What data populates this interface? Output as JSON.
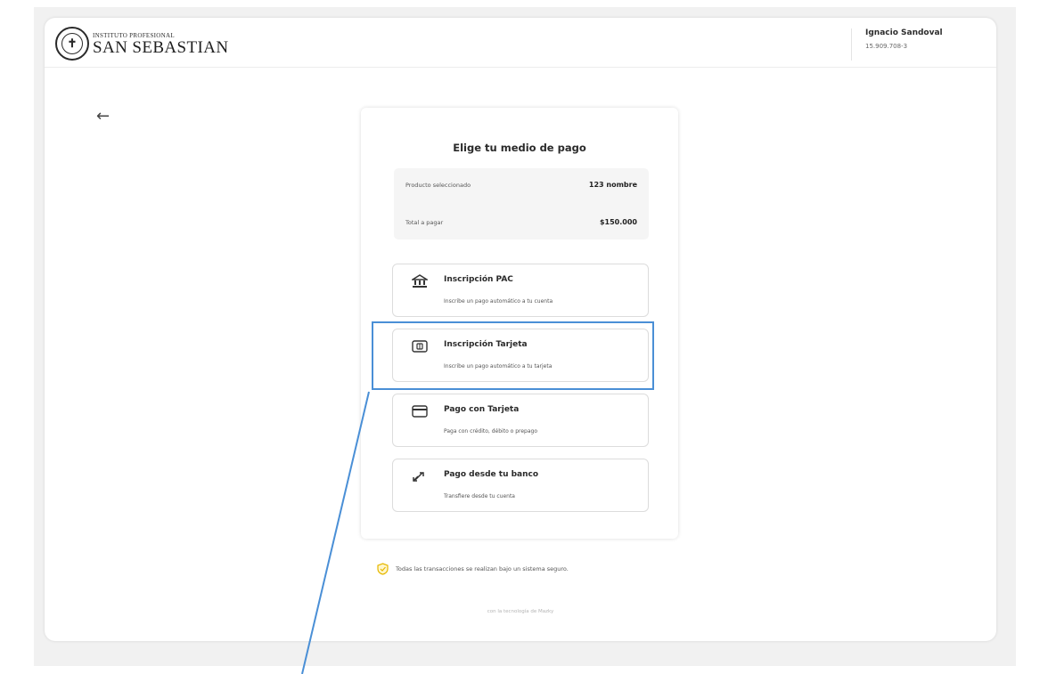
{
  "header": {
    "logo_line1": "INSTITUTO PROFESIONAL",
    "logo_line2": "SAN SEBASTIAN",
    "user_name": "Ignacio Sandoval",
    "user_id": "15.909.708-3"
  },
  "icons": {
    "back": "arrow-left-icon",
    "pac": "bank-icon",
    "card_signup": "card-chip-icon",
    "card_pay": "credit-card-icon",
    "bank_transfer": "transfer-arrows-icon",
    "secure": "shield-icon"
  },
  "colors": {
    "highlight": "#4a8fd6",
    "shield": "#e6b800"
  },
  "main": {
    "title": "Elige tu medio de pago",
    "summary": {
      "product_label": "Producto seleccionado",
      "product_value": "123 nombre",
      "total_label": "Total a pagar",
      "total_value": "$150.000"
    },
    "options": [
      {
        "title": "Inscripción PAC",
        "subtitle": "Inscribe un pago automático a tu cuenta"
      },
      {
        "title": "Inscripción Tarjeta",
        "subtitle": "Inscribe un pago automático a tu tarjeta"
      },
      {
        "title": "Pago con Tarjeta",
        "subtitle": "Paga con crédito, débito o prepago"
      },
      {
        "title": "Pago desde tu banco",
        "subtitle": "Transfiere desde tu cuenta"
      }
    ]
  },
  "footer": {
    "secure_text": "Todas las transacciones se realizan bajo un sistema seguro.",
    "powered": "con la tecnología de Mazky"
  }
}
